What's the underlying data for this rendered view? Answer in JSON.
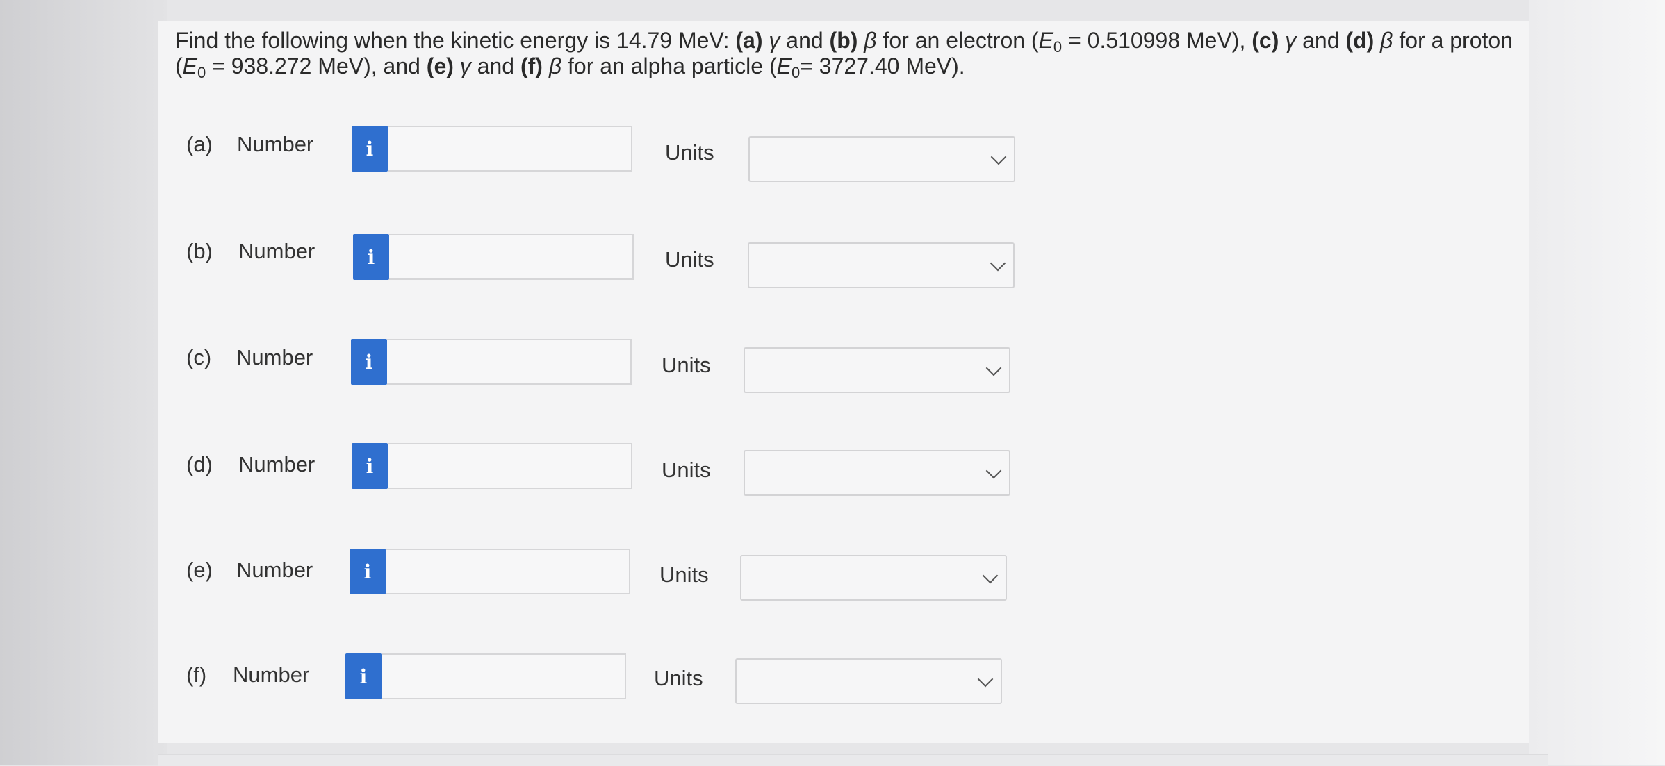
{
  "question": {
    "intro": "Find the following when the kinetic energy is 14.79 MeV: ",
    "a_tag": "(a)",
    "gamma": "γ",
    "and": " and ",
    "b_tag": "(b)",
    "beta": "β",
    "electron": " for an electron (",
    "E": "E",
    "zero": "0",
    "electron_val": " = 0.510998 MeV), ",
    "c_tag": "(c)",
    "d_tag": "(d)",
    "proton": " for a proton",
    "proton_val": " = 938.272 MeV), and ",
    "e_tag": "(e)",
    "f_tag": "(f)",
    "alpha": " for an alpha particle (",
    "alpha_val": "= 3727.40 MeV)."
  },
  "rows": [
    {
      "part": "(a)",
      "number_label": "Number",
      "info": "i",
      "units_label": "Units",
      "value": "",
      "units": ""
    },
    {
      "part": "(b)",
      "number_label": "Number",
      "info": "i",
      "units_label": "Units",
      "value": "",
      "units": ""
    },
    {
      "part": "(c)",
      "number_label": "Number",
      "info": "i",
      "units_label": "Units",
      "value": "",
      "units": ""
    },
    {
      "part": "(d)",
      "number_label": "Number",
      "info": "i",
      "units_label": "Units",
      "value": "",
      "units": ""
    },
    {
      "part": "(e)",
      "number_label": "Number",
      "info": "i",
      "units_label": "Units",
      "value": "",
      "units": ""
    },
    {
      "part": "(f)",
      "number_label": "Number",
      "info": "i",
      "units_label": "Units",
      "value": "",
      "units": ""
    }
  ],
  "colors": {
    "info_button": "#2f6fcf",
    "background": "#f4f4f5"
  }
}
